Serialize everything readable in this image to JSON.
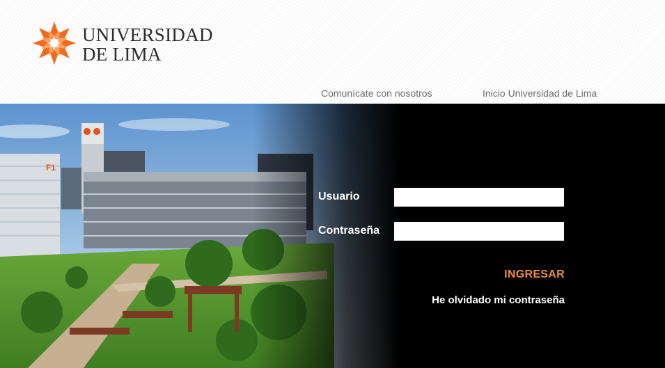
{
  "brand": {
    "line1": "UNIVERSIDAD",
    "line2": "DE LIMA",
    "colors": {
      "orange": "#f26b1d",
      "text": "#2b2b2b"
    },
    "logo_icon": "starburst-logo-icon"
  },
  "nav": {
    "contact": "Comunícate con nosotros",
    "home": "Inicio Universidad de Lima"
  },
  "login": {
    "user_label": "Usuario",
    "user_value": "",
    "password_label": "Contraseña",
    "password_value": "",
    "submit": "INGRESAR",
    "forgot": "He olvidado mi contraseña",
    "accent": "#f28c3a"
  },
  "hero": {
    "tower_sign": "F1"
  }
}
